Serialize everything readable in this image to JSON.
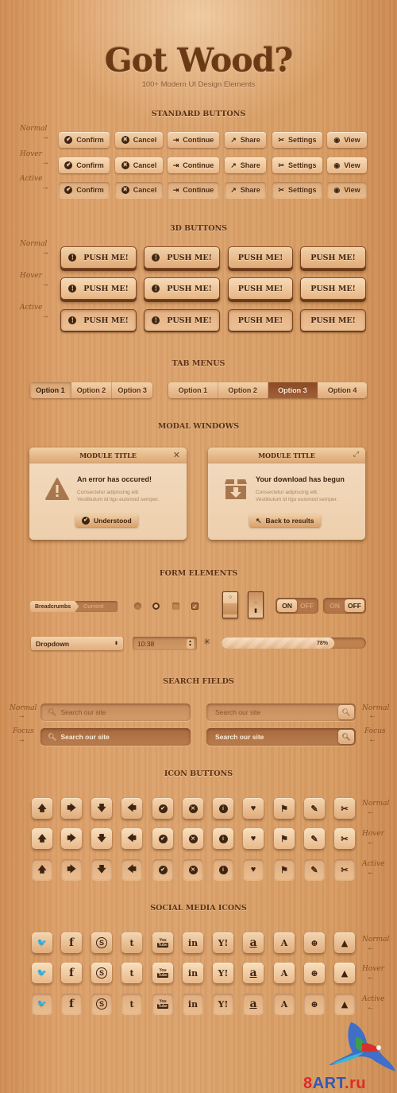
{
  "header": {
    "title": "Got Wood?",
    "subtitle": "100+ Modern UI Design Elements"
  },
  "states": {
    "normal": "Normal",
    "hover": "Hover",
    "active": "Active",
    "focus": "Focus"
  },
  "sections": {
    "standard_buttons": "STANDARD BUTTONS",
    "buttons_3d": "3D BUTTONS",
    "tab_menus": "TAB MENUS",
    "modal_windows": "MODAL WINDOWS",
    "form_elements": "FORM ELEMENTS",
    "search_fields": "SEARCH FIELDS",
    "icon_buttons": "ICON BUTTONS",
    "social_media_icons": "SOCIAL MEDIA ICONS"
  },
  "standard_buttons": [
    {
      "label": "Confirm",
      "icon": "check-circle-icon",
      "glyph": "✔"
    },
    {
      "label": "Cancel",
      "icon": "x-circle-icon",
      "glyph": "✕"
    },
    {
      "label": "Continue",
      "icon": "enter-icon",
      "glyph": "⇥"
    },
    {
      "label": "Share",
      "icon": "share-icon",
      "glyph": "↗"
    },
    {
      "label": "Settings",
      "icon": "tools-icon",
      "glyph": "✂"
    },
    {
      "label": "View",
      "icon": "eye-icon",
      "glyph": "◉"
    }
  ],
  "buttons_3d": {
    "label": "PUSH ME!",
    "icon_glyph": "!"
  },
  "tab_menus": [
    {
      "tabs": [
        "Option 1",
        "Option 2",
        "Option 3"
      ],
      "selected": 0
    },
    {
      "tabs": [
        "Option 1",
        "Option 2",
        "Option 3",
        "Option 4"
      ],
      "selected": 2
    }
  ],
  "modals": [
    {
      "title": "MODULE TITLE",
      "control": "close-icon",
      "control_glyph": "✕",
      "icon": "warning-icon",
      "heading": "An error has occured!",
      "text1": "Consectetur adipiscing elit.",
      "text2": "Vestibulum id ligu euismod semper.",
      "button": "Understood",
      "button_icon": "check-circle-icon",
      "button_glyph": "✔"
    },
    {
      "title": "MODULE TITLE",
      "control": "expand-icon",
      "control_glyph": "⤢",
      "icon": "download-box-icon",
      "heading": "Your download has begun",
      "text1": "Consectetur adipiscing elit.",
      "text2": "Vestibulum id ligu euismod semper.",
      "button": "Back to results",
      "button_icon": "arrow-up-left-icon",
      "button_glyph": "↖"
    }
  ],
  "form": {
    "breadcrumb": [
      "Breadcrumbs",
      "Current"
    ],
    "toggles": [
      {
        "on_label": "ON",
        "off_label": "OFF",
        "state": "on"
      },
      {
        "on_label": "ON",
        "off_label": "OFF",
        "state": "off"
      }
    ],
    "dropdown": {
      "value": "Dropdown",
      "arrows": "▲\n▼"
    },
    "time_spinner": {
      "value": "10:38"
    },
    "progress": {
      "value": 78,
      "label": "78%"
    }
  },
  "search": {
    "placeholder": "Search our site",
    "glyph": "⚲"
  },
  "icon_buttons": [
    {
      "name": "arrow-up-icon",
      "glyph": "🡅"
    },
    {
      "name": "arrow-right-icon",
      "glyph": "🡆"
    },
    {
      "name": "arrow-down-icon",
      "glyph": "🡇"
    },
    {
      "name": "arrow-left-icon",
      "glyph": "🡄"
    },
    {
      "name": "check-icon",
      "glyph": "✔"
    },
    {
      "name": "cancel-icon",
      "glyph": "✕"
    },
    {
      "name": "info-icon",
      "glyph": "i"
    },
    {
      "name": "heart-icon",
      "glyph": "♥"
    },
    {
      "name": "flag-icon",
      "glyph": "⚑"
    },
    {
      "name": "edit-icon",
      "glyph": "✎"
    },
    {
      "name": "tools-icon",
      "glyph": "✂"
    }
  ],
  "social_icons": [
    {
      "name": "twitter-icon",
      "glyph": "🐦"
    },
    {
      "name": "facebook-icon",
      "glyph": "f"
    },
    {
      "name": "skype-icon",
      "glyph": "S"
    },
    {
      "name": "tumblr-icon",
      "glyph": "t"
    },
    {
      "name": "youtube-icon",
      "glyph": "You|Tube"
    },
    {
      "name": "linkedin-icon",
      "glyph": "in"
    },
    {
      "name": "yahoo-icon",
      "glyph": "Y!"
    },
    {
      "name": "amazon-icon",
      "glyph": "a"
    },
    {
      "name": "app-store-icon",
      "glyph": "A"
    },
    {
      "name": "dribbble-icon",
      "glyph": "⊕"
    },
    {
      "name": "forrst-icon",
      "glyph": "▲"
    }
  ],
  "watermark": {
    "text1": "8",
    "text2": "ART",
    "text3": ".ru"
  },
  "colors": {
    "wood": "#dba26d",
    "dark_brown": "#3e2412",
    "selected_tab": "#8a4a22"
  }
}
